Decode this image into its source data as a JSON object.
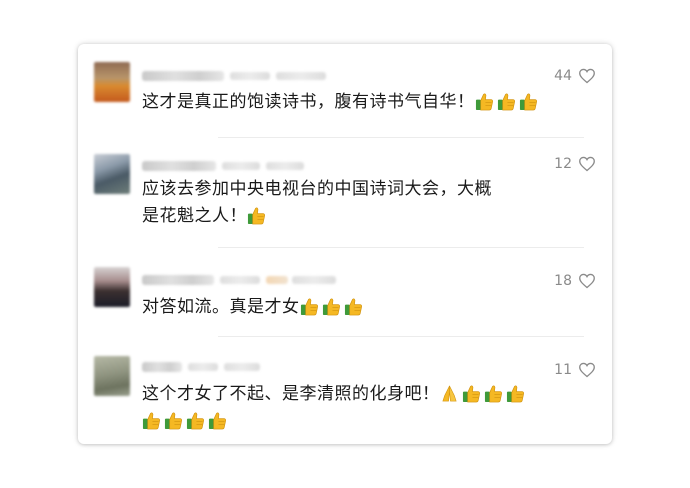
{
  "comments": [
    {
      "likes": "44",
      "text": "这才是真正的饱读诗书，腹有诗书气自华！",
      "emoji": [
        "thumbs-up",
        "thumbs-up",
        "thumbs-up"
      ]
    },
    {
      "likes": "12",
      "text": "应该去参加中央电视台的中国诗词大会，大概是花魁之人！",
      "emoji": [
        "thumbs-up"
      ]
    },
    {
      "likes": "18",
      "text": "对答如流。真是才女",
      "emoji": [
        "thumbs-up",
        "thumbs-up",
        "thumbs-up"
      ]
    },
    {
      "likes": "11",
      "text": "这个才女了不起、是李清照的化身吧！",
      "emoji": [
        "praying-hands",
        "thumbs-up",
        "thumbs-up",
        "thumbs-up",
        "thumbs-up",
        "thumbs-up",
        "thumbs-up",
        "thumbs-up"
      ]
    }
  ],
  "colors": {
    "like_count": "#8a8a8a",
    "text": "#1a1a1a",
    "thumb": "#f5b823",
    "sleeve": "#3f9a3a"
  }
}
